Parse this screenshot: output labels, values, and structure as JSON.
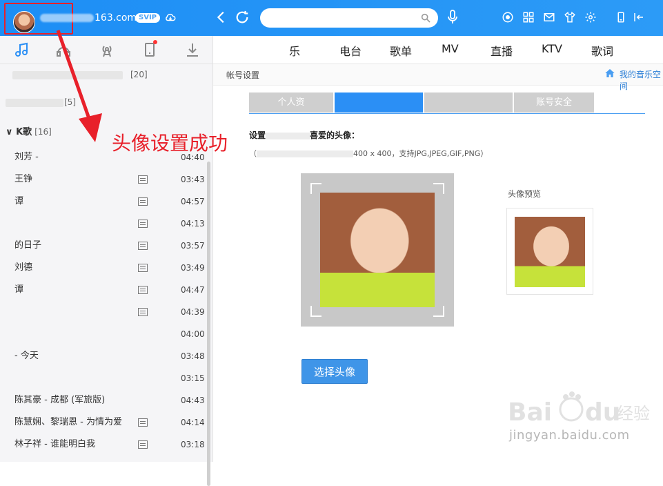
{
  "topbar": {
    "username_suffix": "163.com",
    "svip_badge": "SVIP",
    "search_placeholder": ""
  },
  "sidebar": {
    "list1_count": "[20]",
    "list2_count": "[5]",
    "group_name": "K歌",
    "group_count": "[16]",
    "songs": [
      {
        "title": "刘芳 - ",
        "duration": "04:40",
        "mv": false
      },
      {
        "title": "王铮",
        "duration": "03:43",
        "mv": true
      },
      {
        "title": "谭",
        "duration": "04:57",
        "mv": true
      },
      {
        "title": "",
        "duration": "04:13",
        "mv": true
      },
      {
        "title": "的日子",
        "duration": "03:57",
        "mv": true
      },
      {
        "title": "刘德",
        "duration": "03:49",
        "mv": true
      },
      {
        "title": "谭",
        "duration": "04:47",
        "mv": true
      },
      {
        "title": "",
        "duration": "04:39",
        "mv": true
      },
      {
        "title": "",
        "duration": "04:00",
        "mv": false
      },
      {
        "title": "- 今天",
        "duration": "03:48",
        "mv": false
      },
      {
        "title": "",
        "duration": "03:15",
        "mv": false
      },
      {
        "title": "陈其豪 - 成都 (军旅版)",
        "duration": "04:43",
        "mv": false
      },
      {
        "title": "陈慧娴、黎瑞恩 - 为情为爱",
        "duration": "04:14",
        "mv": true
      },
      {
        "title": "林子祥 - 谁能明白我",
        "duration": "03:18",
        "mv": true
      }
    ]
  },
  "main": {
    "nav": [
      "乐",
      "电台",
      "歌单",
      "MV",
      "直播",
      "KTV",
      "歌词"
    ],
    "breadcrumb": "帐号设置",
    "home_link": "我的音乐空间",
    "tabs": [
      "个人资",
      "",
      "",
      "账号安全"
    ],
    "set_label": "设置",
    "set_label_tail": "喜爱的头像：",
    "hint": "（",
    "hint_tail": "400 x 400，支持JPG,JPEG,GIF,PNG）",
    "preview_label": "头像预览",
    "choose_button": "选择头像"
  },
  "annotation": {
    "text": "头像设置成功"
  },
  "watermark": {
    "brand": "Bai du 经验",
    "url": "jingyan.baidu.com"
  },
  "colors": {
    "topbar": "#1d8ef5",
    "accent": "#2b8ff5",
    "annotation_red": "#e8202a"
  }
}
